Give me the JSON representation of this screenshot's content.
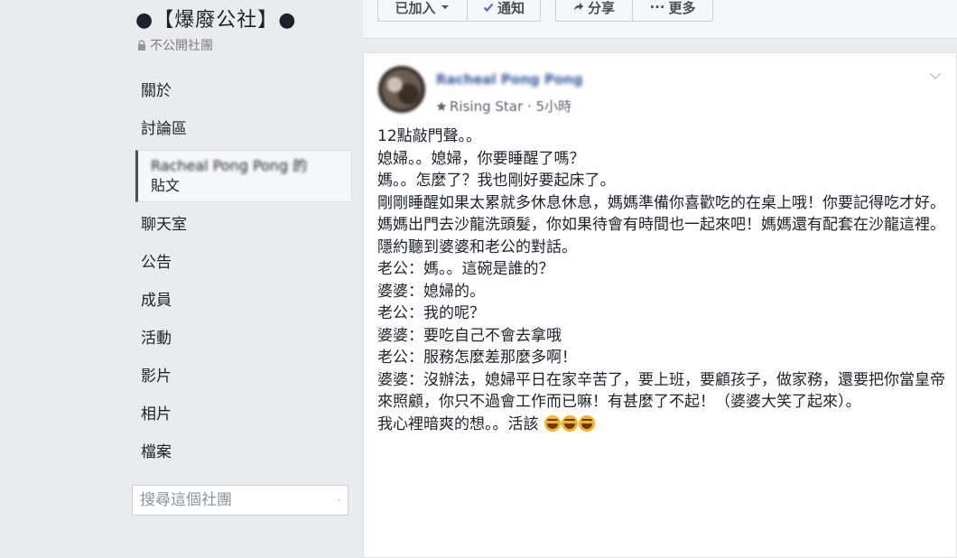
{
  "group": {
    "title": "●【爆廢公社】●",
    "privacy": "不公開社團"
  },
  "nav": {
    "items": [
      "關於",
      "討論區"
    ],
    "active_item": [
      "Racheal Pong Pong 的",
      "貼文"
    ],
    "items_after": [
      "聊天室",
      "公告",
      "成員",
      "活動",
      "影片",
      "相片",
      "檔案"
    ]
  },
  "search": {
    "placeholder": "搜尋這個社團"
  },
  "actions": {
    "joined": "已加入",
    "notify": "通知",
    "share": "分享",
    "more": "更多"
  },
  "post": {
    "author": "Racheal Pong Pong",
    "badge": "Rising Star",
    "time": "5小時",
    "lines": [
      "12點敲門聲。。",
      "媳婦。。媳婦，你要睡醒了嗎？",
      "媽。。怎麼了？我也剛好要起床了。",
      "剛剛睡醒如果太累就多休息休息，媽媽準備你喜歡吃的在桌上哦！你要記得吃才好。",
      "媽媽出門去沙龍洗頭髮，你如果待會有時間也一起來吧！媽媽還有配套在沙龍這裡。",
      "隱約聽到婆婆和老公的對話。",
      "老公：媽。。這碗是誰的？",
      "婆婆：媳婦的。",
      "老公：我的呢？",
      "婆婆：要吃自己不會去拿哦",
      "老公：服務怎麼差那麼多啊！",
      "婆婆：沒辦法，媳婦平日在家辛苦了，要上班，要顧孩子，做家務，還要把你當皇帝來照顧，你只不過會工作而已嘛！有甚麼了不起！（婆婆大笑了起來）。"
    ],
    "last_line": "我心裡暗爽的想。。活該"
  },
  "colors": {
    "background": "#e9ebee",
    "link": "#365899",
    "text": "#1d2129",
    "muted": "#606770"
  },
  "icons": [
    "lock-icon",
    "chevron-down-icon",
    "check-icon",
    "share-arrow-icon",
    "more-dots-icon",
    "search-icon",
    "star-badge-icon",
    "laughing-emoji-icon"
  ]
}
